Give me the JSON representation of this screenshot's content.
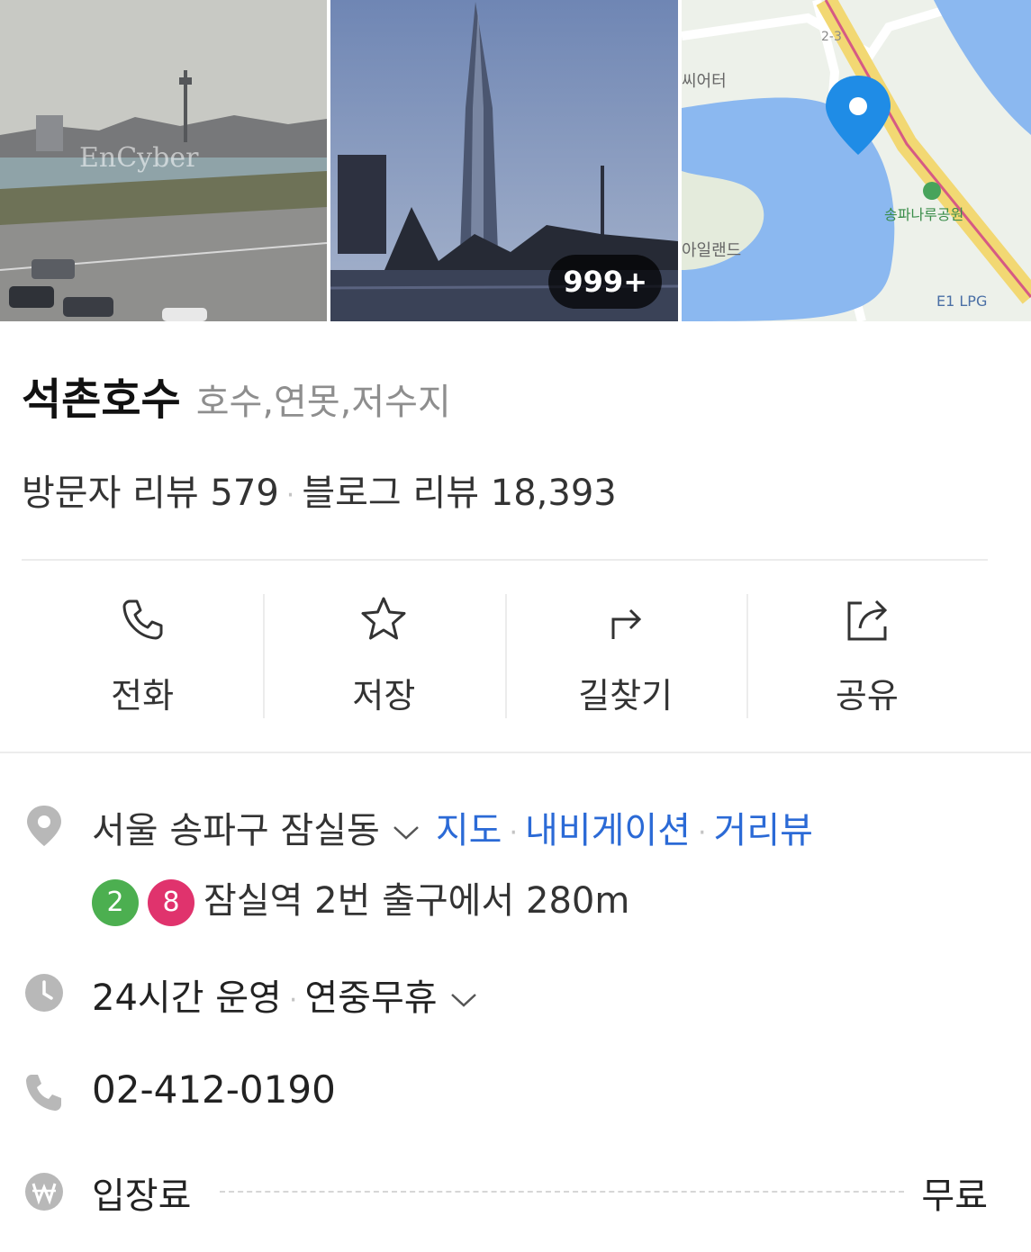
{
  "photos": {
    "photo1_watermark": "EnCyber",
    "photo_count": "999+",
    "map_labels": {
      "road": "2-3",
      "theater": "씨어터",
      "park": "송파나루공원",
      "island": "아일랜드",
      "gas": "E1 LPG"
    }
  },
  "place": {
    "name": "석촌호수",
    "category": "호수,연못,저수지"
  },
  "reviews": {
    "visitor": "방문자 리뷰 579",
    "blog": "블로그 리뷰 18,393",
    "dot": "·"
  },
  "actions": {
    "call": "전화",
    "save": "저장",
    "directions": "길찾기",
    "share": "공유"
  },
  "address": {
    "text": "서울 송파구 잠실동",
    "map": "지도",
    "navigation": "내비게이션",
    "street_view": "거리뷰",
    "dot": "·"
  },
  "subway": {
    "line_a": "2",
    "line_b": "8",
    "line_a_color": "#4caf50",
    "line_b_color": "#e0336d",
    "text": "잠실역 2번 출구에서 280m"
  },
  "hours": {
    "text": "24시간 운영",
    "dot": "·",
    "holiday": "연중무휴"
  },
  "phone": {
    "number": "02-412-0190"
  },
  "fee": {
    "label": "입장료",
    "value": "무료"
  },
  "icons": {
    "location": "map-pin-icon",
    "clock": "clock-icon",
    "phone": "phone-icon",
    "won": "won-icon"
  },
  "colors": {
    "link": "#2b6ad6",
    "map_pin": "#1f8ce6"
  }
}
